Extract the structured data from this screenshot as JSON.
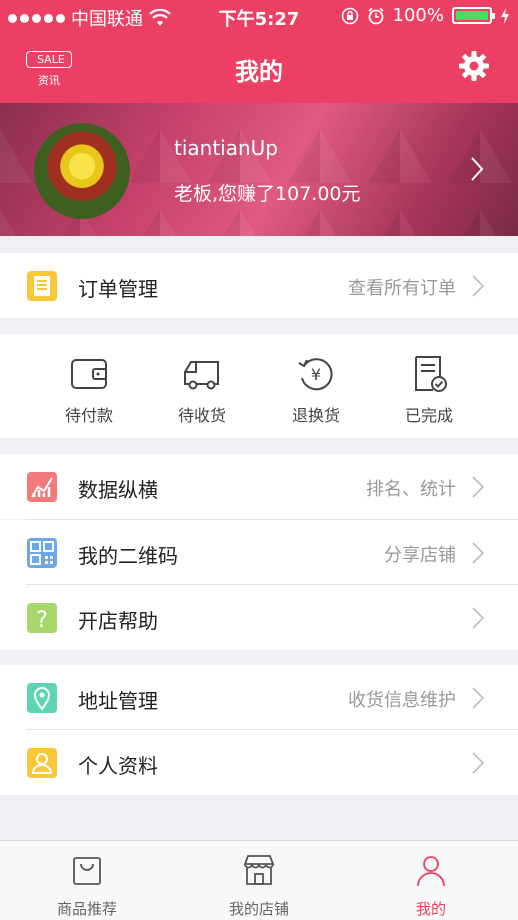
{
  "status_bar": {
    "carrier": "中国联通",
    "time": "下午5:27",
    "battery": "100%"
  },
  "header": {
    "sale_tag": "SALE",
    "sale_label": "资讯",
    "title": "我的"
  },
  "profile": {
    "username": "tiantianUp",
    "earnings": "老板,您赚了107.00元"
  },
  "orders": {
    "label": "订单管理",
    "link": "查看所有订单"
  },
  "quick_actions": [
    {
      "label": "待付款",
      "icon": "wallet-icon"
    },
    {
      "label": "待收货",
      "icon": "truck-icon"
    },
    {
      "label": "退换货",
      "icon": "yen-refund-icon"
    },
    {
      "label": "已完成",
      "icon": "completed-document-icon"
    }
  ],
  "menu_group_1": [
    {
      "label": "数据纵横",
      "sub": "排名、统计",
      "icon": "chart-icon",
      "color": "#f27a7a"
    },
    {
      "label": "我的二维码",
      "sub": "分享店铺",
      "icon": "qrcode-icon",
      "color": "#6aa8e8"
    },
    {
      "label": "开店帮助",
      "sub": "",
      "icon": "help-icon",
      "color": "#a8d86a"
    }
  ],
  "menu_group_2": [
    {
      "label": "地址管理",
      "sub": "收货信息维护",
      "icon": "location-icon",
      "color": "#5dd4b4"
    },
    {
      "label": "个人资料",
      "sub": "",
      "icon": "person-icon",
      "color": "#f8c83a"
    }
  ],
  "tabs": [
    {
      "label": "商品推荐",
      "icon": "shopping-bag-icon"
    },
    {
      "label": "我的店铺",
      "icon": "store-icon"
    },
    {
      "label": "我的",
      "icon": "user-icon"
    }
  ],
  "colors": {
    "brand": "#ec3f64",
    "background": "#efeff4"
  }
}
